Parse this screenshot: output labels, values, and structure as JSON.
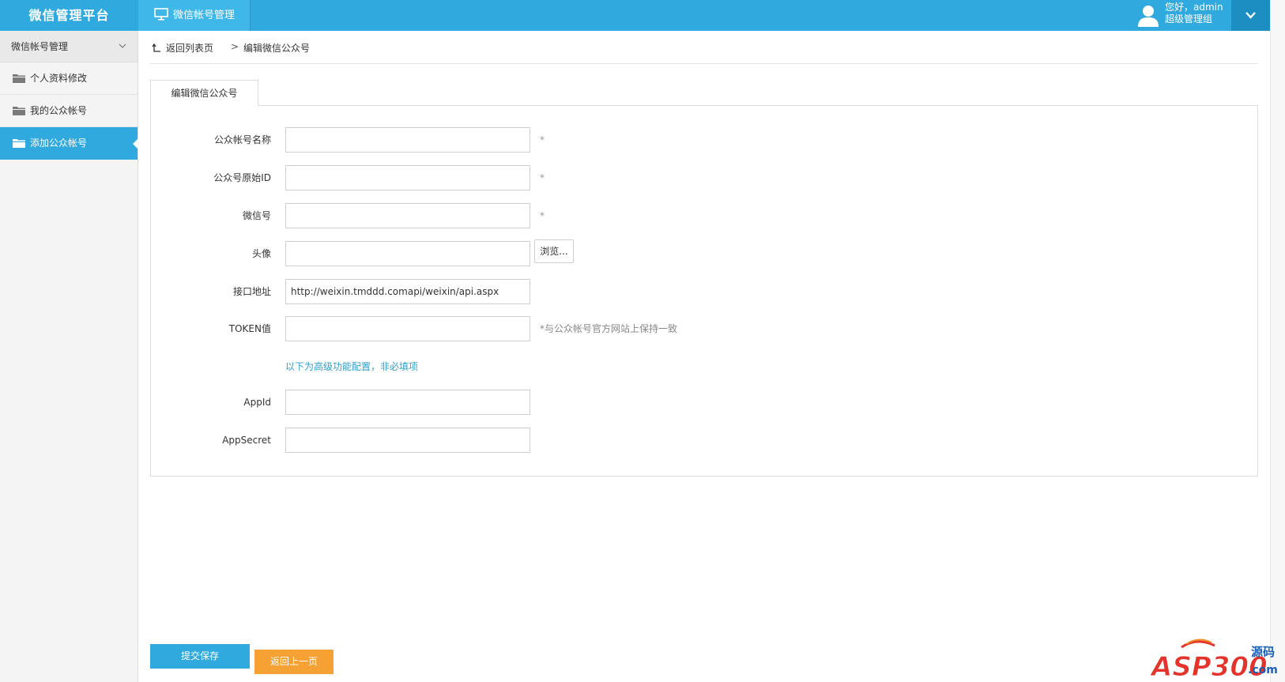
{
  "header": {
    "app_title": "微信管理平台",
    "module_tab": "微信帐号管理",
    "user_greeting": "您好，admin",
    "user_role": "超级管理组"
  },
  "sidebar": {
    "section_title": "微信帐号管理",
    "items": [
      {
        "label": "个人资料修改",
        "active": false
      },
      {
        "label": "我的公众帐号",
        "active": false
      },
      {
        "label": "添加公众帐号",
        "active": true
      }
    ]
  },
  "breadcrumb": {
    "back_label": "返回列表页",
    "separator": ">",
    "current": "编辑微信公众号"
  },
  "form": {
    "tab_label": "编辑微信公众号",
    "fields": {
      "name": {
        "label": "公众帐号名称",
        "value": "",
        "required": "*"
      },
      "origin_id": {
        "label": "公众号原始ID",
        "value": "",
        "required": "*"
      },
      "wechat_id": {
        "label": "微信号",
        "value": "",
        "required": "*"
      },
      "avatar": {
        "label": "头像",
        "value": "",
        "browse_label": "浏览..."
      },
      "api_url": {
        "label": "接口地址",
        "value": "http://weixin.tmddd.comapi/weixin/api.aspx"
      },
      "token": {
        "label": "TOKEN值",
        "value": "",
        "hint": "*与公众帐号官方网站上保持一致"
      },
      "app_id": {
        "label": "AppId",
        "value": ""
      },
      "app_secret": {
        "label": "AppSecret",
        "value": ""
      }
    },
    "advanced_note": "以下为高级功能配置，非必填项"
  },
  "actions": {
    "submit_label": "提交保存",
    "back_label": "返回上一页"
  },
  "watermark": {
    "brand": "ASP300",
    "suffix_top": "源码",
    "suffix_bottom": ".com"
  },
  "colors": {
    "primary": "#2fa9de",
    "primary_dark": "#1d8ec2",
    "accent_orange": "#f5a133",
    "link_blue": "#2fa0cc"
  }
}
